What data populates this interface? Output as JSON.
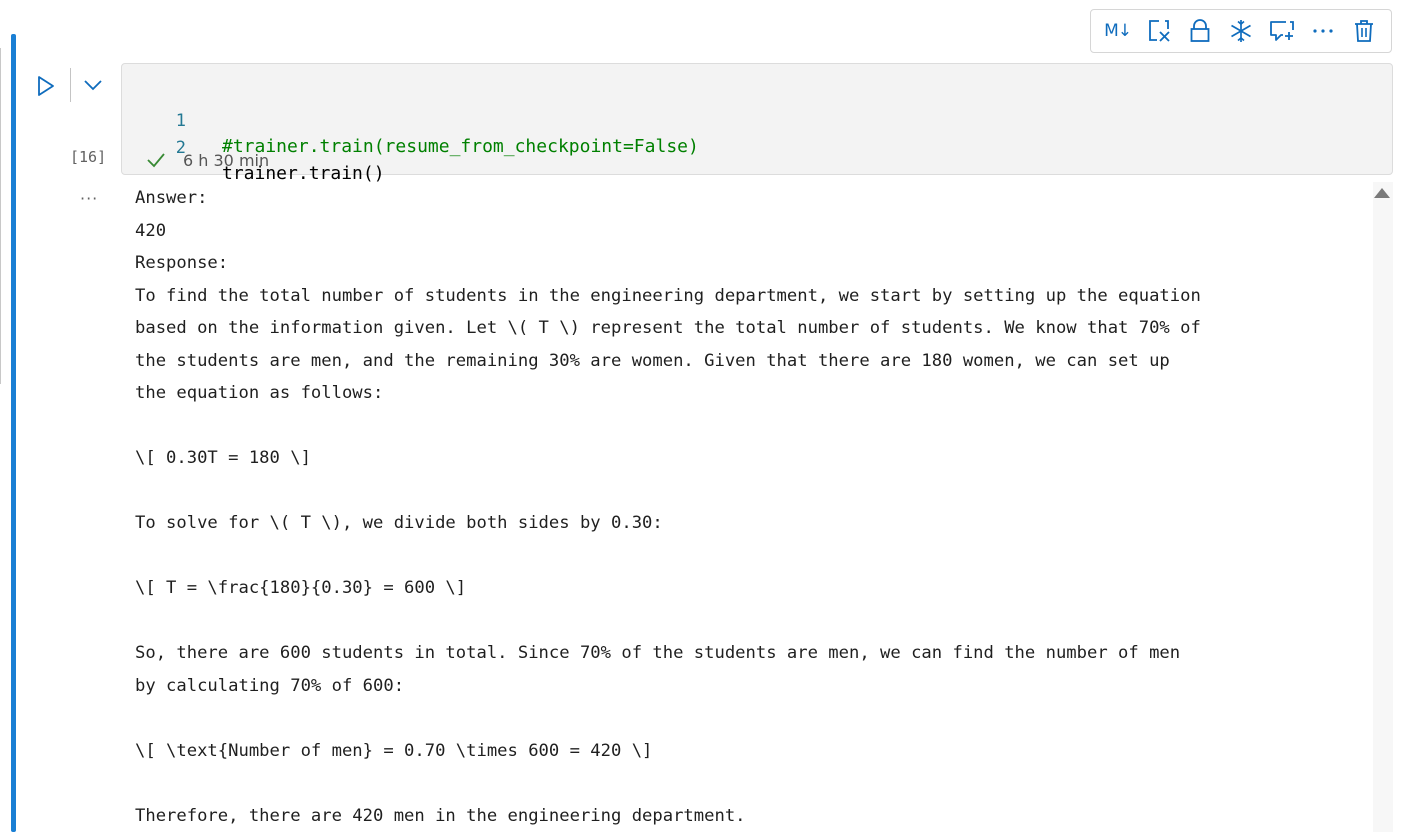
{
  "toolbar": {
    "markdown_label": "M↓",
    "items": [
      "markdown-toggle",
      "clear-output",
      "lock",
      "freeze",
      "comment",
      "more",
      "delete"
    ]
  },
  "cell": {
    "execution_count": "[16]",
    "status": "succeeded",
    "duration": "6 h 30 min",
    "code": [
      {
        "line": "1",
        "text": "#trainer.train(resume_from_checkpoint=False)"
      },
      {
        "line": "2",
        "text": "trainer.train()"
      }
    ]
  },
  "output": {
    "more_label": "···",
    "lines": [
      "Answer:",
      "420",
      "Response:",
      "To find the total number of students in the engineering department, we start by setting up the equation",
      "based on the information given. Let \\( T \\) represent the total number of students. We know that 70% of",
      "the students are men, and the remaining 30% are women. Given that there are 180 women, we can set up",
      "the equation as follows:",
      "",
      "\\[ 0.30T = 180 \\]",
      "",
      "To solve for \\( T \\), we divide both sides by 0.30:",
      "",
      "\\[ T = \\frac{180}{0.30} = 600 \\]",
      "",
      "So, there are 600 students in total. Since 70% of the students are men, we can find the number of men",
      "by calculating 70% of 600:",
      "",
      "\\[ \\text{Number of men} = 0.70 \\times 600 = 420 \\]",
      "",
      "Therefore, there are 420 men in the engineering department."
    ]
  },
  "colors": {
    "accent": "#0f6cbd",
    "cell_bar": "#1a7fd4",
    "comment": "#008000",
    "line_number": "#237893",
    "success": "#388a34"
  }
}
